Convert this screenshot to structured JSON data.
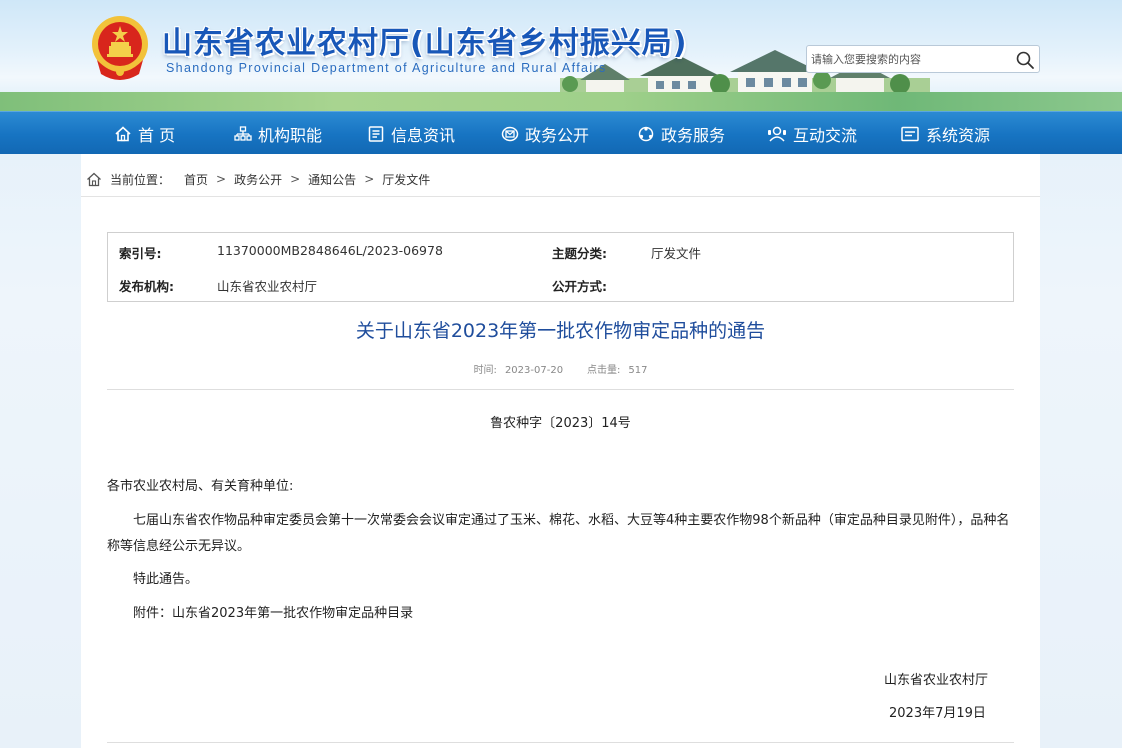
{
  "header": {
    "title": "山东省农业农村厅(山东省乡村振兴局)",
    "subtitle": "Shandong Provincial Department of Agriculture and Rural Affairs",
    "search_placeholder": "请输入您要搜索的内容"
  },
  "nav": {
    "items": [
      {
        "label": "首 页",
        "icon": "home-icon"
      },
      {
        "label": "机构职能",
        "icon": "org-icon"
      },
      {
        "label": "信息资讯",
        "icon": "document-icon"
      },
      {
        "label": "政务公开",
        "icon": "disclosure-icon"
      },
      {
        "label": "政务服务",
        "icon": "service-icon"
      },
      {
        "label": "互动交流",
        "icon": "interaction-icon"
      },
      {
        "label": "系统资源",
        "icon": "resource-icon"
      }
    ]
  },
  "breadcrumb": {
    "label": "当前位置：",
    "items": [
      "首页",
      "政务公开",
      "通知公告",
      "厅发文件"
    ],
    "separator": ">"
  },
  "meta": {
    "index_key": "索引号:",
    "index_value": "11370000MB2848646L/2023-06978",
    "topic_key": "主题分类:",
    "topic_value": "厅发文件",
    "publisher_key": "发布机构:",
    "publisher_value": "山东省农业农村厅",
    "disclosure_key": "公开方式:",
    "disclosure_value": ""
  },
  "article": {
    "title": "关于山东省2023年第一批农作物审定品种的通告",
    "time_label": "时间:",
    "time_value": "2023-07-20",
    "views_label": "点击量:",
    "views_value": "517",
    "doc_number": "鲁农种字〔2023〕14号",
    "salutation": "各市农业农村局、有关育种单位:",
    "body_line1": "七届山东省农作物品种审定委员会第十一次常委会会议审定通过了玉米、棉花、水稻、大豆等4种主要农作物98个新品种（审定品种目录见附件），品种名",
    "body_line2": "称等信息经公示无异议。",
    "closing": "特此通告。",
    "attachment": "附件：山东省2023年第一批农作物审定品种目录",
    "signature": "山东省农业农村厅",
    "date": "2023年7月19日"
  },
  "colors": {
    "nav_blue": "#1774c2",
    "title_blue": "#1f4d9c",
    "header_title": "#1857b8"
  }
}
